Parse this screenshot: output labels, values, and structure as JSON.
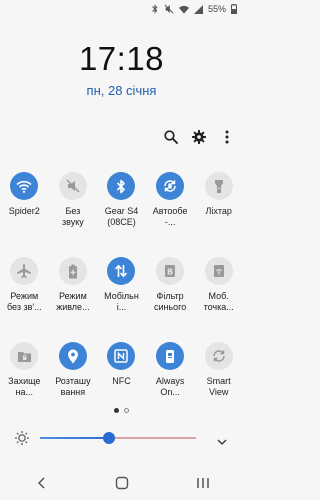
{
  "status": {
    "battery": "55%"
  },
  "lockscreen": {
    "time": "17:18",
    "date": "пн, 28 січня"
  },
  "toolbar": {
    "icons": [
      "search-icon",
      "gear-icon",
      "more-vert-icon"
    ]
  },
  "tiles": [
    {
      "label": "Spider2",
      "icon": "wifi-icon",
      "state": "on"
    },
    {
      "label": "Без\nзвуку",
      "icon": "mute-icon",
      "state": "off"
    },
    {
      "label": "Gear S4\n(08CE)",
      "icon": "bluetooth-icon",
      "state": "on"
    },
    {
      "label": "Автообе\n-...",
      "icon": "autorotate-icon",
      "state": "on"
    },
    {
      "label": "Ліхтар",
      "icon": "flashlight-icon",
      "state": "off"
    },
    {
      "label": "Режим\nбез зв'...",
      "icon": "airplane-icon",
      "state": "off"
    },
    {
      "label": "Режим\nживле...",
      "icon": "power-saving-icon",
      "state": "off"
    },
    {
      "label": "Мобільн\nі...",
      "icon": "mobile-data-icon",
      "state": "on"
    },
    {
      "label": "Фільтр\nсинього",
      "icon": "blue-light-filter-icon",
      "state": "off"
    },
    {
      "label": "Моб.\nточка...",
      "icon": "hotspot-icon",
      "state": "off"
    },
    {
      "label": "Захище\nна...",
      "icon": "secure-folder-icon",
      "state": "off"
    },
    {
      "label": "Розташу\nвання",
      "icon": "location-icon",
      "state": "on"
    },
    {
      "label": "NFC",
      "icon": "nfc-icon",
      "state": "on"
    },
    {
      "label": "Always\nOn...",
      "icon": "always-on-display-icon",
      "state": "on"
    },
    {
      "label": "Smart\nView",
      "icon": "smart-view-icon",
      "state": "off"
    }
  ],
  "pager": {
    "current": 1,
    "total": 2
  },
  "brightness": {
    "level": 0.44
  },
  "colors": {
    "accent": "#3d84d6",
    "inactive": "#e4e4e4",
    "date": "#1e5fad"
  },
  "navigation": [
    "back-icon",
    "home-icon",
    "recents-icon"
  ]
}
